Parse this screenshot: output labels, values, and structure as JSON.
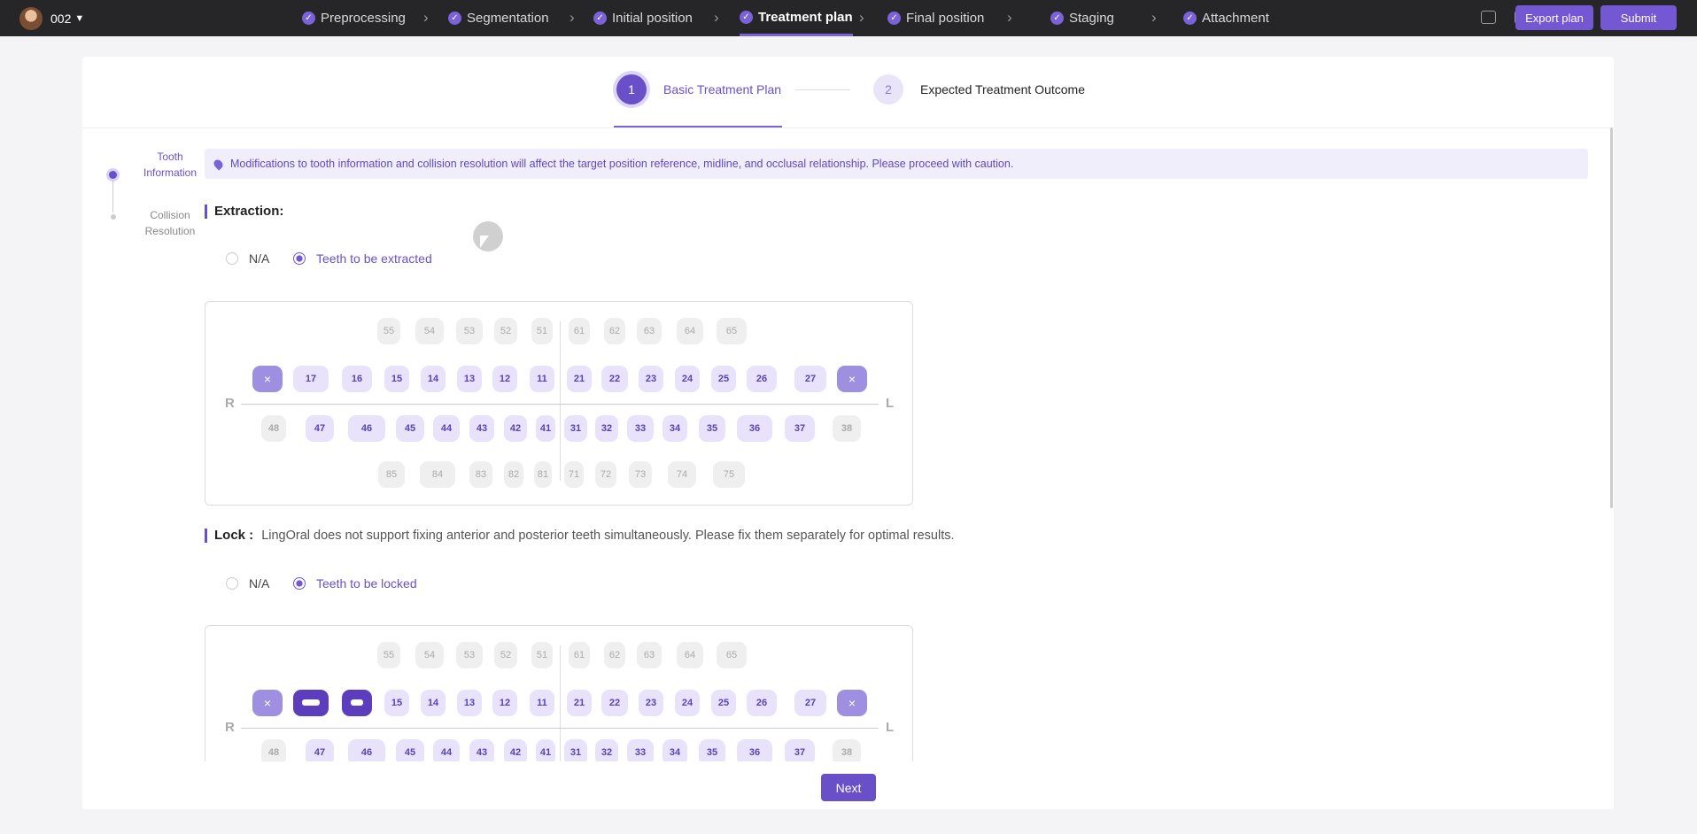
{
  "header": {
    "user_id": "002",
    "steps": [
      {
        "label": "Preprocessing",
        "state": "done"
      },
      {
        "label": "Segmentation",
        "state": "done"
      },
      {
        "label": "Initial position",
        "state": "done"
      },
      {
        "label": "Treatment plan",
        "state": "active"
      },
      {
        "label": "Final position",
        "state": "done"
      },
      {
        "label": "Staging",
        "state": "done"
      },
      {
        "label": "Attachment",
        "state": "done"
      }
    ],
    "export_label": "Export plan",
    "submit_label": "Submit"
  },
  "wizard": {
    "step1": {
      "number": "1",
      "label": "Basic Treatment Plan"
    },
    "step2": {
      "number": "2",
      "label": "Expected Treatment Outcome"
    }
  },
  "side_steps": [
    "Tooth Information",
    "Collision Resolution"
  ],
  "notice": "Modifications to tooth information and collision resolution will affect the target position reference, midline, and occlusal relationship. Please proceed with caution.",
  "extraction": {
    "title": "Extraction:",
    "option_na": "N/A",
    "option_yes": "Teeth to be extracted",
    "selected": "yes"
  },
  "lock": {
    "title": "Lock :",
    "note": "LingOral does not support fixing anterior and posterior teeth simultaneously. Please fix them separately for optimal results.",
    "option_na": "N/A",
    "option_yes": "Teeth to be locked",
    "selected": "yes"
  },
  "chart_labels": {
    "right": "R",
    "left": "L"
  },
  "teeth": {
    "upper_primary": [
      "55",
      "54",
      "53",
      "52",
      "51",
      "61",
      "62",
      "63",
      "64",
      "65"
    ],
    "upper_permanent": [
      "18",
      "17",
      "16",
      "15",
      "14",
      "13",
      "12",
      "11",
      "21",
      "22",
      "23",
      "24",
      "25",
      "26",
      "27",
      "28"
    ],
    "lower_permanent": [
      "48",
      "47",
      "46",
      "45",
      "44",
      "43",
      "42",
      "41",
      "31",
      "32",
      "33",
      "34",
      "35",
      "36",
      "37",
      "38"
    ],
    "lower_primary": [
      "85",
      "84",
      "83",
      "82",
      "81",
      "71",
      "72",
      "73",
      "74",
      "75"
    ]
  },
  "extraction_chart": {
    "extracted": [
      "18",
      "28"
    ]
  },
  "lock_chart": {
    "extracted": [
      "18",
      "28"
    ],
    "locked": [
      "17",
      "16"
    ]
  },
  "absent_teeth": [
    "48",
    "38"
  ],
  "tooth_marks": {
    "extracted": "×"
  },
  "next_label": "Next",
  "colors": {
    "accent": "#6a50c8",
    "topbar": "#262628"
  }
}
